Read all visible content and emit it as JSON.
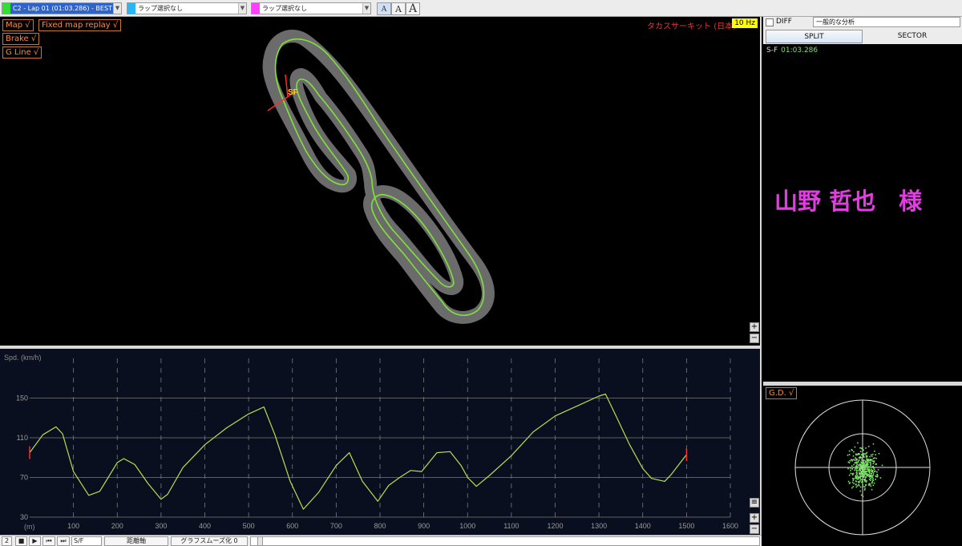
{
  "toolbar": {
    "lap1": {
      "label": "C2 - Lap 01  (01:03.286) - BEST",
      "color": "#33dd33"
    },
    "lap2": {
      "label": "ラップ選択なし",
      "color": "#29b6f6"
    },
    "lap3": {
      "label": "ラップ選択なし",
      "color": "#ff40ff"
    },
    "font_small": "A",
    "font_medium": "A",
    "font_large": "A"
  },
  "map": {
    "toggles": {
      "map": "Map  √",
      "fixed_replay": "Fixed map replay  √",
      "brake": "Brake  √",
      "gline": "G Line √"
    },
    "track_name": "タカスサーキット (日本)",
    "hz": "10 Hz",
    "sf_label": "SF",
    "zoom_in": "+",
    "zoom_out": "−"
  },
  "graph": {
    "ylabel": "Spd. (km/h)",
    "xunit": "(m)",
    "menu": "≡",
    "zoom_in": "+",
    "zoom_out": "−"
  },
  "chart_data": {
    "type": "line",
    "ylabel": "Spd. (km/h)",
    "xlabel": "(m)",
    "xlim": [
      0,
      1600
    ],
    "ylim": [
      30,
      190
    ],
    "yticks": [
      30,
      70,
      110,
      150
    ],
    "xticks": [
      100,
      200,
      300,
      400,
      500,
      600,
      700,
      800,
      900,
      1000,
      1100,
      1200,
      1300,
      1400,
      1500,
      1600
    ],
    "series": [
      {
        "color": "#b6e04b",
        "x": [
          0,
          30,
          60,
          75,
          100,
          135,
          160,
          200,
          215,
          240,
          270,
          300,
          315,
          350,
          400,
          450,
          500,
          535,
          560,
          595,
          625,
          660,
          700,
          730,
          760,
          795,
          820,
          845,
          870,
          895,
          930,
          960,
          985,
          1000,
          1020,
          1050,
          1100,
          1150,
          1200,
          1250,
          1300,
          1315,
          1340,
          1370,
          1400,
          1420,
          1450,
          1465,
          1500
        ],
        "y": [
          95,
          113,
          121,
          114,
          76,
          52,
          56,
          85,
          89,
          83,
          64,
          48,
          53,
          80,
          103,
          120,
          134,
          141,
          113,
          66,
          38,
          55,
          82,
          95,
          66,
          46,
          62,
          70,
          77,
          76,
          95,
          96,
          82,
          70,
          61,
          72,
          92,
          116,
          132,
          142,
          152,
          154,
          131,
          103,
          79,
          69,
          66,
          73,
          93
        ]
      }
    ]
  },
  "bottombar": {
    "lap_num": "2",
    "stop": "■",
    "play": "▶",
    "first": "⏮",
    "last": "⏭",
    "section": "S/F",
    "axis_mode": "距離軸",
    "smoothing": "グラフスムーズ化 0"
  },
  "right": {
    "diff_label": "DIFF",
    "analysis": "一般的な分析",
    "tab_split": "SPLIT",
    "tab_sector": "SECTOR",
    "split_name": "S-F",
    "split_time": "01:03.286",
    "customer": "山野 哲也　様",
    "gd_toggle": "G.D.  √"
  }
}
